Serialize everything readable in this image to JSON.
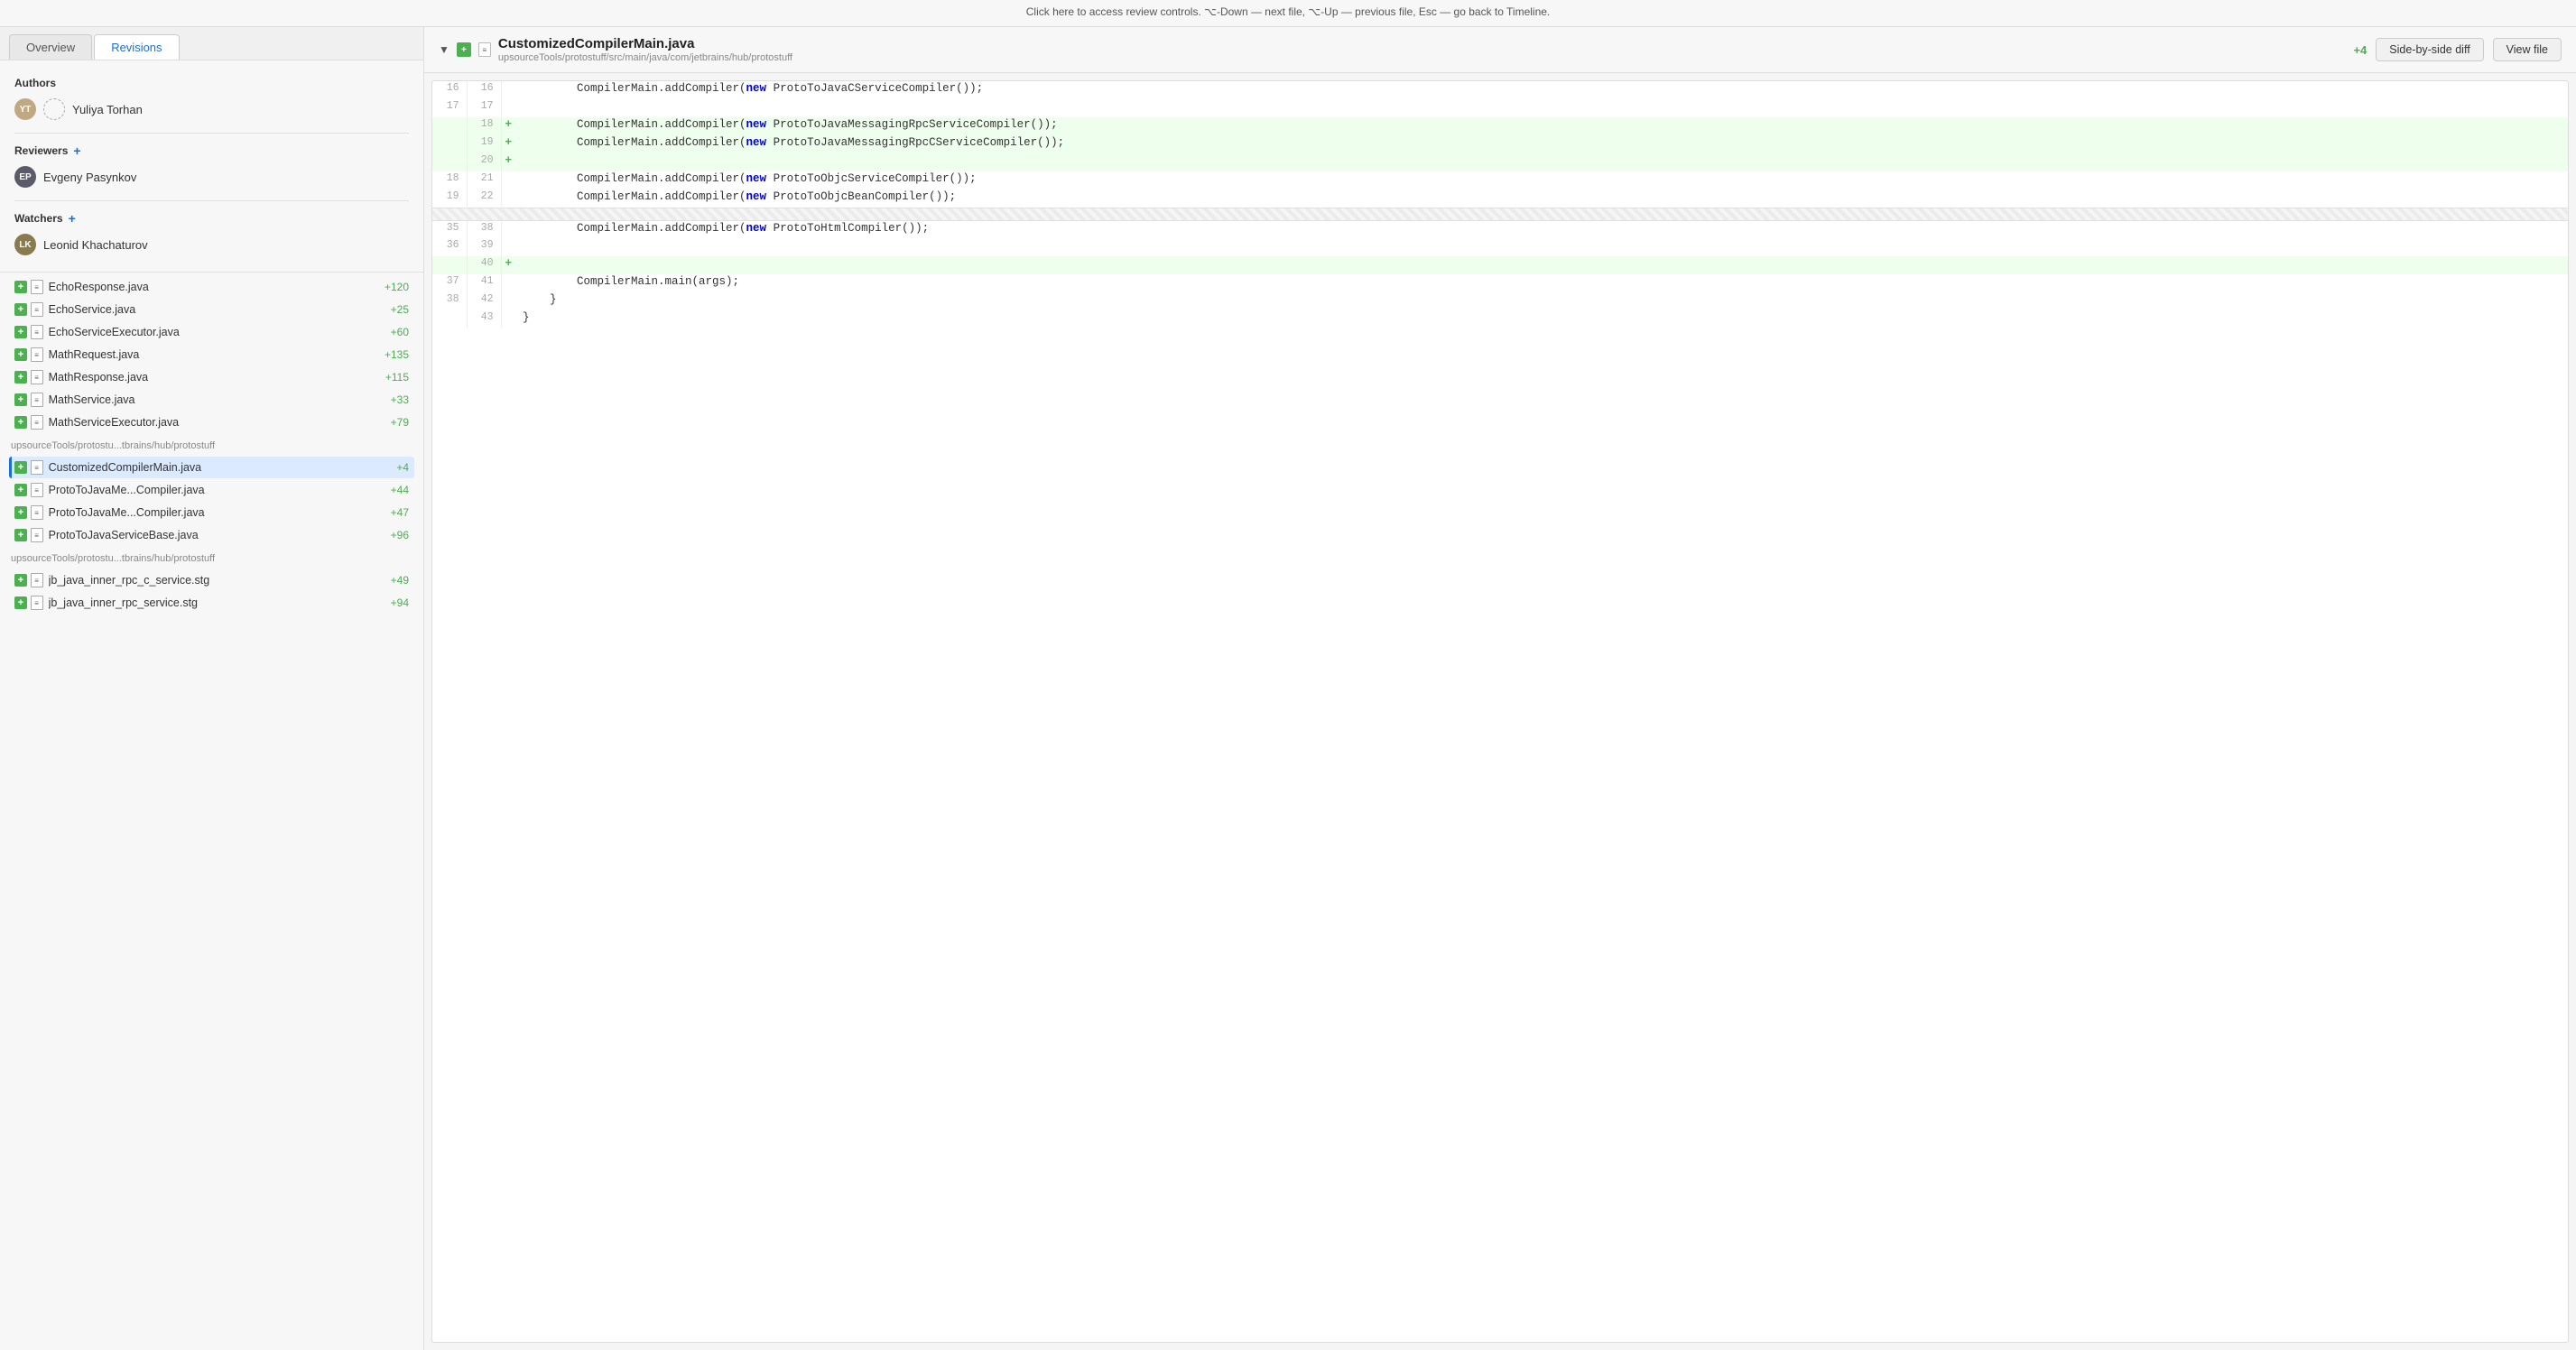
{
  "topBar": {
    "message": "Click here to access review controls.  ⌥-Down — next file,  ⌥-Up — previous file,  Esc — go back to Timeline."
  },
  "sidebar": {
    "tabs": [
      {
        "id": "overview",
        "label": "Overview"
      },
      {
        "id": "revisions",
        "label": "Revisions"
      }
    ],
    "activeTab": "revisions",
    "authors": {
      "label": "Authors",
      "people": [
        {
          "name": "Yuliya Torhan",
          "initials": "YT",
          "hasGhost": true
        }
      ]
    },
    "reviewers": {
      "label": "Reviewers",
      "people": [
        {
          "name": "Evgeny Pasynkov",
          "initials": "EP"
        }
      ]
    },
    "watchers": {
      "label": "Watchers",
      "people": [
        {
          "name": "Leonid Khachaturov",
          "initials": "LK"
        }
      ]
    },
    "fileSections": [
      {
        "path": "",
        "files": [
          {
            "name": "EchoResponse.java",
            "delta": "+120",
            "active": false
          },
          {
            "name": "EchoService.java",
            "delta": "+25",
            "active": false
          },
          {
            "name": "EchoServiceExecutor.java",
            "delta": "+60",
            "active": false
          },
          {
            "name": "MathRequest.java",
            "delta": "+135",
            "active": false
          },
          {
            "name": "MathResponse.java",
            "delta": "+115",
            "active": false
          },
          {
            "name": "MathService.java",
            "delta": "+33",
            "active": false
          },
          {
            "name": "MathServiceExecutor.java",
            "delta": "+79",
            "active": false
          }
        ]
      },
      {
        "path": "upsourceTools/protostu...tbrains/hub/protostuff",
        "files": [
          {
            "name": "CustomizedCompilerMain.java",
            "delta": "+4",
            "active": true
          },
          {
            "name": "ProtoToJavaMe...Compiler.java",
            "delta": "+44",
            "active": false
          },
          {
            "name": "ProtoToJavaMe...Compiler.java",
            "delta": "+47",
            "active": false
          },
          {
            "name": "ProtoToJavaServiceBase.java",
            "delta": "+96",
            "active": false
          }
        ]
      },
      {
        "path": "upsourceTools/protostu...tbrains/hub/protostuff",
        "files": [
          {
            "name": "jb_java_inner_rpc_c_service.stg",
            "delta": "+49",
            "active": false
          },
          {
            "name": "jb_java_inner_rpc_service.stg",
            "delta": "+94",
            "active": false
          }
        ]
      }
    ]
  },
  "fileHeader": {
    "title": "CustomizedCompilerMain.java",
    "path": "upsourceTools/protostuff/src/main/java/com/jetbrains/hub/protostuff",
    "delta": "+4",
    "actions": {
      "sideBySide": "Side-by-side diff",
      "viewFile": "View file"
    }
  },
  "codeLines": [
    {
      "oldNum": "16",
      "newNum": "16",
      "marker": "",
      "code": "        CompilerMain.addCompiler(new ProtoToJavaCServiceCompiler());",
      "added": false
    },
    {
      "oldNum": "17",
      "newNum": "17",
      "marker": "",
      "code": "",
      "added": false
    },
    {
      "oldNum": "",
      "newNum": "18",
      "marker": "+",
      "code": "        CompilerMain.addCompiler(new ProtoToJavaMessagingRpcServiceCompiler());",
      "added": true
    },
    {
      "oldNum": "",
      "newNum": "19",
      "marker": "+",
      "code": "        CompilerMain.addCompiler(new ProtoToJavaMessagingRpcCServiceCompiler());",
      "added": true
    },
    {
      "oldNum": "",
      "newNum": "20",
      "marker": "+",
      "code": "",
      "added": true
    },
    {
      "oldNum": "18",
      "newNum": "21",
      "marker": "",
      "code": "        CompilerMain.addCompiler(new ProtoToObjcServiceCompiler());",
      "added": false
    },
    {
      "oldNum": "19",
      "newNum": "22",
      "marker": "",
      "code": "        CompilerMain.addCompiler(new ProtoToObjcBeanCompiler());",
      "added": false
    },
    {
      "separator": true
    },
    {
      "oldNum": "35",
      "newNum": "38",
      "marker": "",
      "code": "        CompilerMain.addCompiler(new ProtoToHtmlCompiler());",
      "added": false
    },
    {
      "oldNum": "36",
      "newNum": "39",
      "marker": "",
      "code": "",
      "added": false
    },
    {
      "oldNum": "",
      "newNum": "40",
      "marker": "+",
      "code": "",
      "added": true
    },
    {
      "oldNum": "37",
      "newNum": "41",
      "marker": "",
      "code": "        CompilerMain.main(args);",
      "added": false
    },
    {
      "oldNum": "38",
      "newNum": "42",
      "marker": "",
      "code": "    }",
      "added": false
    },
    {
      "oldNum": "",
      "newNum": "43",
      "marker": "",
      "code": "}",
      "added": false
    }
  ]
}
